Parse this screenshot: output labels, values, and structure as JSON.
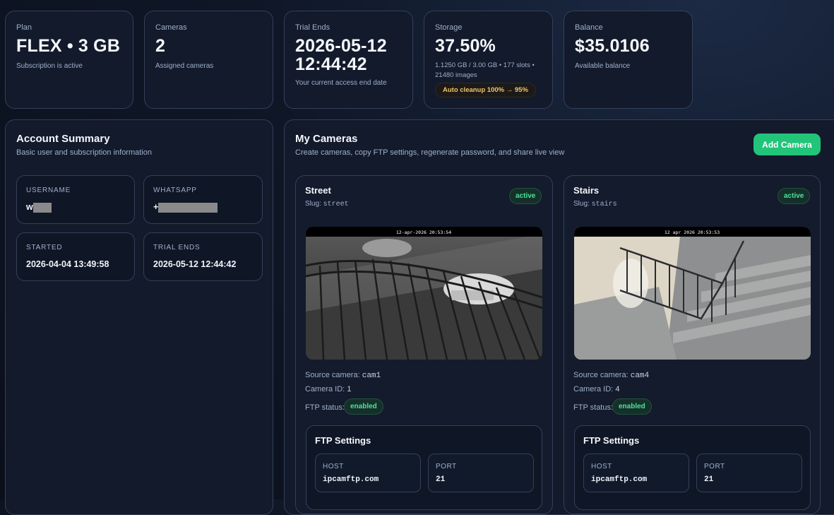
{
  "stats": [
    {
      "label": "Plan",
      "value": "FLEX • 3 GB",
      "sub": "Subscription is active"
    },
    {
      "label": "Cameras",
      "value": "2",
      "sub": "Assigned cameras"
    },
    {
      "label": "Trial Ends",
      "value_line1": "2026-05-12",
      "value_line2": "12:44:42",
      "sub": "Your current access end date"
    },
    {
      "label": "Storage",
      "value": "37.50%",
      "sub_line1": "1.1250 GB / 3.00 GB • 177 slots •",
      "sub_line2": "21480 images",
      "pill": "Auto cleanup 100% → 95%"
    },
    {
      "label": "Balance",
      "value": "$35.0106",
      "sub": "Available balance"
    }
  ],
  "account": {
    "title": "Account Summary",
    "desc": "Basic user and subscription information",
    "username_label": "USERNAME",
    "username_value": "w",
    "whatsapp_label": "WHATSAPP",
    "whatsapp_value": "+",
    "started_label": "STARTED",
    "started_value": "2026-04-04 13:49:58",
    "trial_label": "TRIAL ENDS",
    "trial_value": "2026-05-12 12:44:42"
  },
  "cameras_panel": {
    "title": "My Cameras",
    "desc": "Create cameras, copy FTP settings, regenerate password, and share live view",
    "add_button": "Add Camera"
  },
  "cameras": [
    {
      "name": "Street",
      "slug_label": "Slug:",
      "slug": "street",
      "status": "active",
      "timestamp": "12-apr-2026 20:53:54",
      "source_label": "Source camera:",
      "source": "cam1",
      "id_label": "Camera ID:",
      "id": "1",
      "ftp_label": "FTP status:",
      "ftp_status": "enabled",
      "ftp_title": "FTP Settings",
      "host_label": "HOST",
      "host": "ipcamftp.com",
      "port_label": "PORT",
      "port": "21"
    },
    {
      "name": "Stairs",
      "slug_label": "Slug:",
      "slug": "stairs",
      "status": "active",
      "timestamp": "12 apr 2026 20:53:53",
      "source_label": "Source camera:",
      "source": "cam4",
      "id_label": "Camera ID:",
      "id": "4",
      "ftp_label": "FTP status:",
      "ftp_status": "enabled",
      "ftp_title": "FTP Settings",
      "host_label": "HOST",
      "host": "ipcamftp.com",
      "port_label": "PORT",
      "port": "21"
    }
  ],
  "colors": {
    "accent": "#22c47a",
    "active_badge": "#4ee39a",
    "warn": "#f4c56a",
    "card_bg": "#121a2b"
  }
}
